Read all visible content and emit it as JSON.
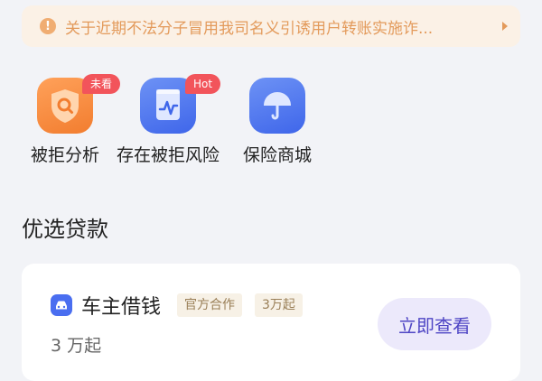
{
  "notice": {
    "icon": "exclamation-icon",
    "text": "关于近期不法分子冒用我司名义引诱用户转账实施诈...",
    "color": "#e39a5b"
  },
  "services": [
    {
      "label": "被拒分析",
      "badge": "未看",
      "icon": "shield-search-icon"
    },
    {
      "label": "存在被拒风险",
      "badge": "Hot",
      "icon": "document-chart-icon"
    },
    {
      "label": "保险商城",
      "badge": "",
      "icon": "umbrella-icon"
    }
  ],
  "section": {
    "title": "优选贷款"
  },
  "loan": {
    "icon": "car-icon",
    "name": "车主借钱",
    "tags": [
      "官方合作",
      "3万起"
    ],
    "amount": "3 万起",
    "button": "立即查看",
    "accent": "#4f46c5"
  }
}
